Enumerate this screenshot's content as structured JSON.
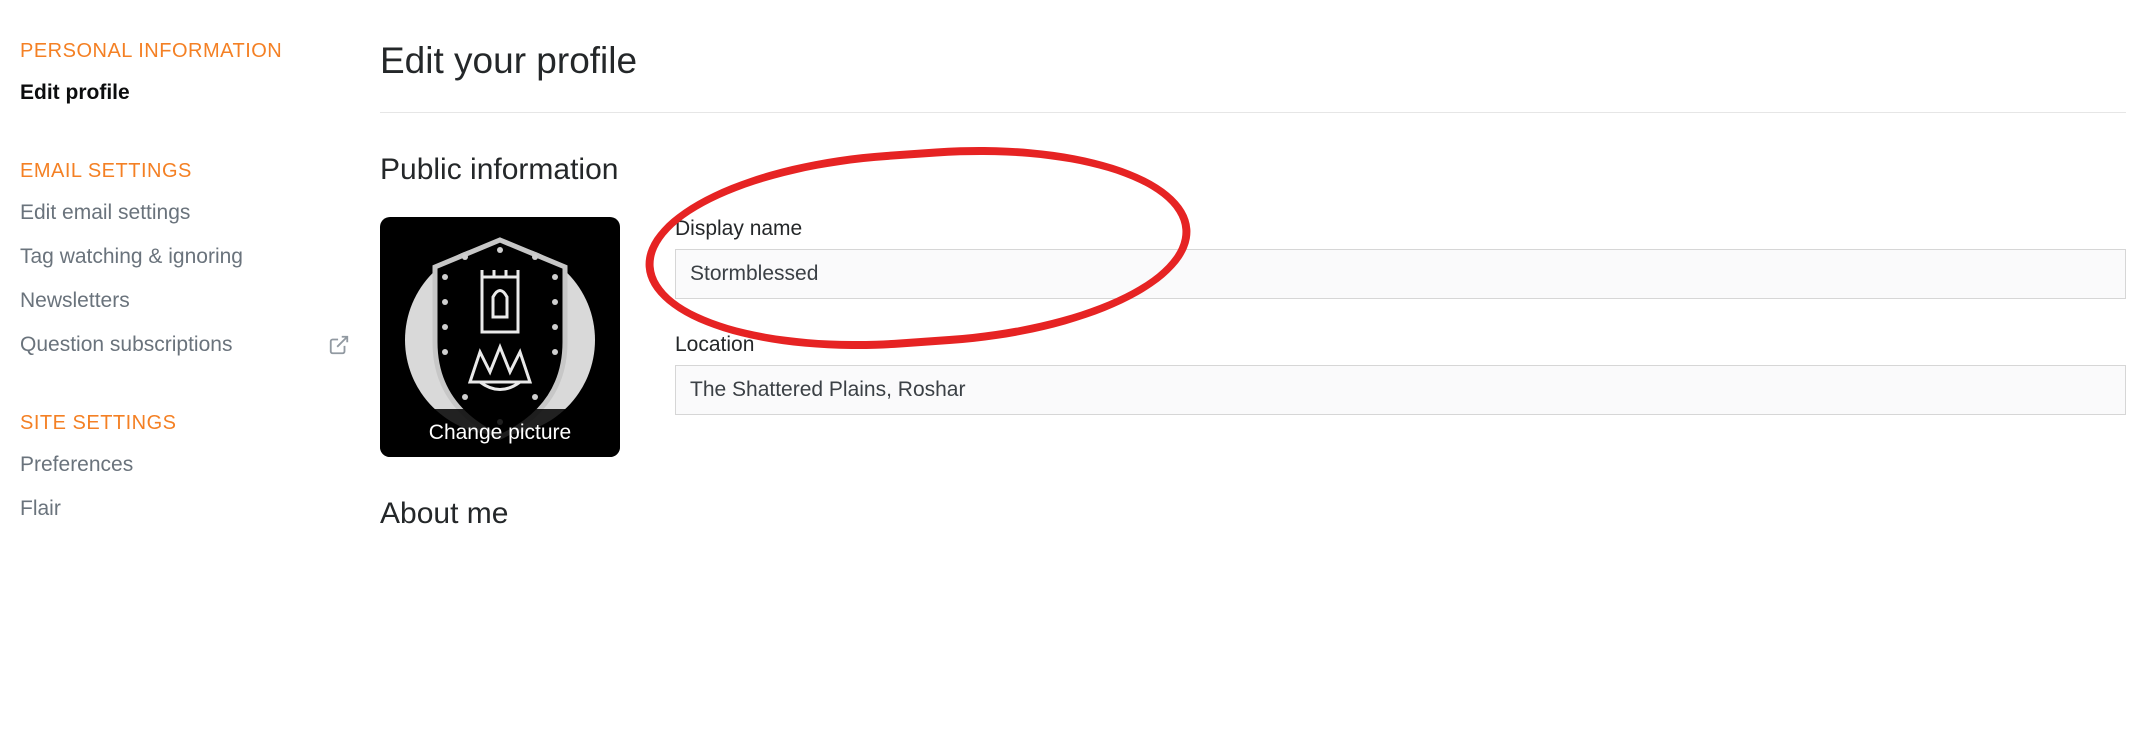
{
  "sidebar": {
    "section1_title": "PERSONAL INFORMATION",
    "section2_title": "EMAIL SETTINGS",
    "section3_title": "SITE SETTINGS",
    "s1_items": [
      {
        "label": "Edit profile"
      }
    ],
    "s2_items": [
      {
        "label": "Edit email settings"
      },
      {
        "label": "Tag watching & ignoring"
      },
      {
        "label": "Newsletters"
      },
      {
        "label": "Question subscriptions"
      }
    ],
    "s3_items": [
      {
        "label": "Preferences"
      },
      {
        "label": "Flair"
      }
    ]
  },
  "main": {
    "title": "Edit your profile",
    "public_info_heading": "Public information",
    "change_picture_label": "Change picture",
    "display_name_label": "Display name",
    "display_name_value": "Stormblessed",
    "location_label": "Location",
    "location_value": "The Shattered Plains, Roshar",
    "about_me_heading": "About me"
  }
}
